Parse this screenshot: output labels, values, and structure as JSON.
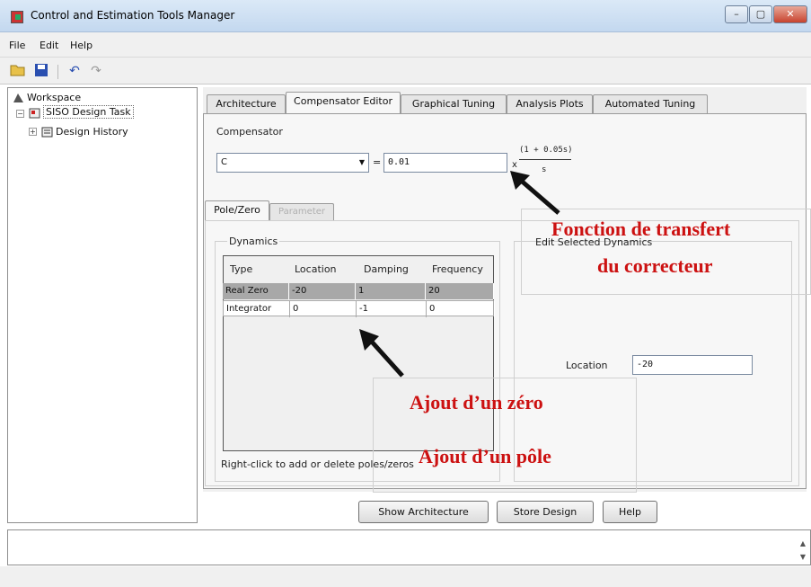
{
  "window": {
    "title": "Control and Estimation Tools Manager"
  },
  "menu": [
    "File",
    "Edit",
    "Help"
  ],
  "toolbar": {
    "icons": [
      "folder-open-icon",
      "save-icon",
      "undo-icon",
      "redo-icon"
    ]
  },
  "tree": {
    "root": "Workspace",
    "task": "SISO Design Task",
    "child": "Design History"
  },
  "tabs": [
    "Architecture",
    "Compensator Editor",
    "Graphical Tuning",
    "Analysis Plots",
    "Automated Tuning"
  ],
  "active_tab": "Compensator Editor",
  "compensator": {
    "group_label": "Compensator",
    "select_value": "C",
    "equals": "=",
    "gain": "0.01",
    "times": "x",
    "numerator": "(1 + 0.05s)",
    "denominator": "s"
  },
  "subtabs": [
    "Pole/Zero",
    "Parameter"
  ],
  "dynamics": {
    "group_label": "Dynamics",
    "columns": [
      "Type",
      "Location",
      "Damping",
      "Frequency"
    ],
    "rows": [
      {
        "type": "Real Zero",
        "location": "-20",
        "damping": "1",
        "frequency": "20"
      },
      {
        "type": "Integrator",
        "location": "0",
        "damping": "-1",
        "frequency": "0"
      }
    ],
    "hint": "Right-click to add or delete poles/zeros"
  },
  "edit_selected": {
    "label": "Edit Selected Dynamics",
    "location_label": "Location",
    "location_value": "-20"
  },
  "buttons": {
    "show_architecture": "Show Architecture",
    "store_design": "Store Design",
    "help": "Help"
  },
  "annotations": {
    "transfer_line1": "Fonction de transfert",
    "transfer_line2": "du correcteur",
    "add_zero": "Ajout d’un zéro",
    "add_pole": "Ajout d’un pôle"
  },
  "colors": {
    "annotation": "#cc1111",
    "selected_row": "#a8a8a8"
  }
}
